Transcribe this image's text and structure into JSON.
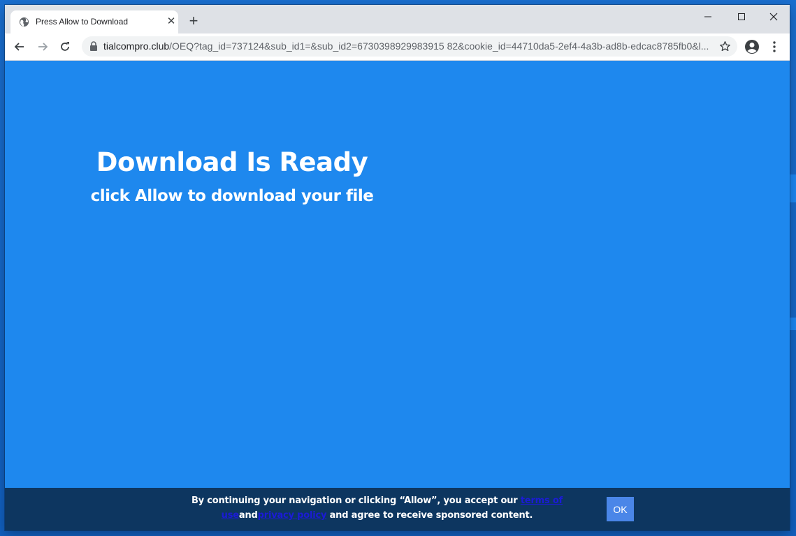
{
  "browser": {
    "tab": {
      "title": "Press Allow to Download",
      "favicon": "globe-icon",
      "close_glyph": "✕"
    },
    "new_tab_glyph": "+",
    "address_bar": {
      "host": "tialcompro.club",
      "path": "/OEQ?tag_id=737124&sub_id1=&sub_id2=6730398929983915 82&cookie_id=44710da5-2ef4-4a3b-ad8b-edcac8785fb0&l..."
    }
  },
  "page": {
    "headline": "Download Is Ready",
    "subline": "click Allow to download your file",
    "consent": {
      "text_before": "By continuing your navigation or clicking “Allow”, you accept our ",
      "terms_link": "terms of use",
      "text_middle": "and",
      "privacy_link": "privacy policy",
      "text_after": " and agree to receive sponsored content.",
      "ok_label": "OK"
    }
  },
  "colors": {
    "page_background": "#1e88ee",
    "consent_bar": "#0d3660",
    "link": "#1b1bd6",
    "ok_button": "#4a86e8"
  }
}
